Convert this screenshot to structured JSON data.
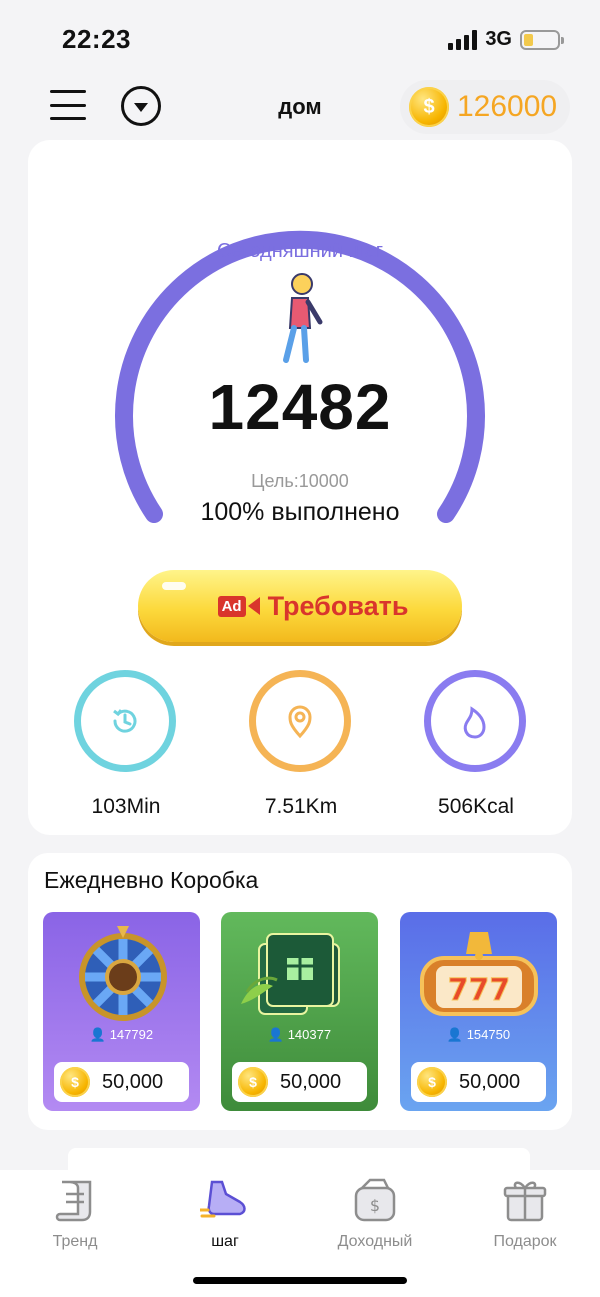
{
  "status_bar": {
    "time": "22:23",
    "network": "3G"
  },
  "header": {
    "title": "дом",
    "coin_balance": "126000"
  },
  "steps": {
    "label": "Сегодняшний шаг",
    "value": "12482",
    "goal": "Цель:10000",
    "completion": "100% выполнено",
    "progress_fraction": 1.0,
    "claim_button": {
      "ad_badge": "Ad",
      "label": "Требовать"
    },
    "stats": {
      "time": "103Min",
      "distance": "7.51Km",
      "calories": "506Kcal"
    }
  },
  "daily_box": {
    "title": "Ежедневно Коробка",
    "items": [
      {
        "name": "wheel",
        "count": "147792",
        "price": "50,000"
      },
      {
        "name": "gift-cards",
        "count": "140377",
        "price": "50,000"
      },
      {
        "name": "slot-777",
        "count": "154750",
        "price": "50,000"
      }
    ]
  },
  "nav": {
    "items": [
      {
        "label": "Тренд"
      },
      {
        "label": "шаг"
      },
      {
        "label": "Доходный"
      },
      {
        "label": "Подарок"
      }
    ],
    "active_index": 1
  },
  "colors": {
    "accent_purple": "#7b6fe0",
    "coin_gold": "#f5a623",
    "claim_red": "#d9352c",
    "ring_cyan": "#6fd3df",
    "ring_orange": "#f5b455",
    "ring_purple": "#8a7cf0"
  }
}
